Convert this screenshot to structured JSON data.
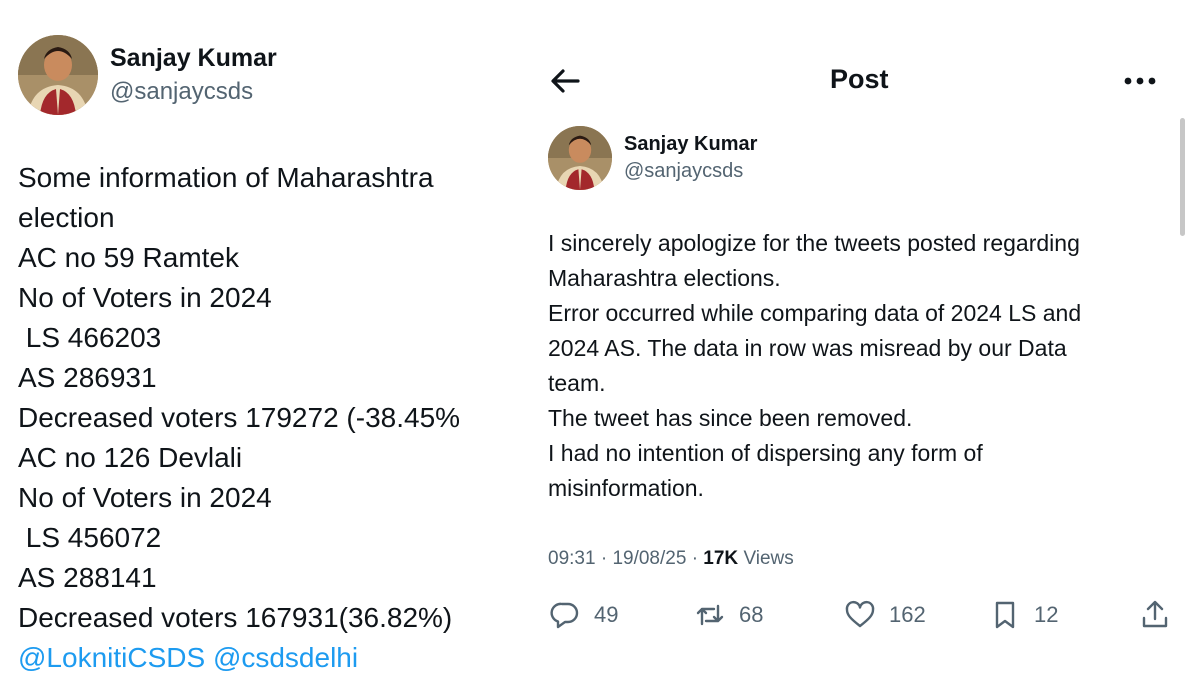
{
  "left_tweet": {
    "author_name": "Sanjay Kumar",
    "author_handle": "@sanjaycsds",
    "lines": [
      "Some information of Maharashtra",
      "election",
      "AC no 59 Ramtek",
      "No of Voters in 2024",
      " LS 466203",
      "AS 286931",
      "Decreased voters 179272 (-38.45%",
      "AC no 126 Devlali",
      "No of Voters in 2024",
      " LS 456072",
      "AS 288141",
      "Decreased voters 167931(36.82%)"
    ],
    "mentions": [
      "@LoknitiCSDS",
      "@csdsdelhi"
    ]
  },
  "right_post": {
    "header_title": "Post",
    "back_icon": "arrow-left-icon",
    "more_icon": "more-horizontal-icon",
    "author_name": "Sanjay Kumar",
    "author_handle": "@sanjaycsds",
    "lines": [
      "I sincerely apologize for the tweets posted regarding",
      "Maharashtra elections.",
      "Error occurred while comparing data of 2024 LS and",
      "2024 AS. The data in row was misread by our Data",
      "team.",
      "The tweet has since been removed.",
      "I had no intention of dispersing any form of",
      "misinformation."
    ],
    "time": "09:31",
    "date": "19/08/25",
    "views_count": "17K",
    "views_label": "Views",
    "actions": {
      "replies": "49",
      "reposts": "68",
      "likes": "162",
      "bookmarks": "12"
    }
  },
  "colors": {
    "text_primary": "#0f1419",
    "text_secondary": "#536471",
    "link": "#1d9bf0"
  }
}
